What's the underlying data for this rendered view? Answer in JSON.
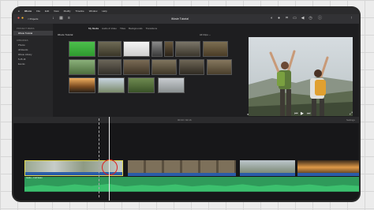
{
  "menubar": {
    "app": "iMovie",
    "items": [
      "File",
      "Edit",
      "View",
      "Modify",
      "Timeline",
      "Window",
      "Help"
    ],
    "clock": ""
  },
  "toolbar": {
    "projects_label": "< Projects",
    "window_title": "iMovie Tutorial"
  },
  "sidebar": {
    "library_header": "PROJECT MEDIA",
    "project_item": "iMovie Tutorial",
    "libraries_header": "LIBRARIES",
    "items": [
      "Photos",
      "All Events",
      "iMovie Library",
      "5.25.18",
      "Events"
    ]
  },
  "browser": {
    "tabs": [
      "My Media",
      "Audio & Video",
      "Titles",
      "Backgrounds",
      "Transitions"
    ],
    "crumb": "iMovie Tutorial",
    "filter": "All Clips ⌄"
  },
  "viewer": {
    "controls": [
      "mic-icon",
      "previous-icon",
      "play-icon",
      "next-icon",
      "fullscreen-icon"
    ]
  },
  "timeline": {
    "timecode": "00:03 / 02:16",
    "settings": "Settings",
    "audio_label": "Audio – Full Swim"
  },
  "colors": {
    "audio": "#2f9a5a",
    "selection": "#e0d84f",
    "annotation": "#e02020"
  }
}
